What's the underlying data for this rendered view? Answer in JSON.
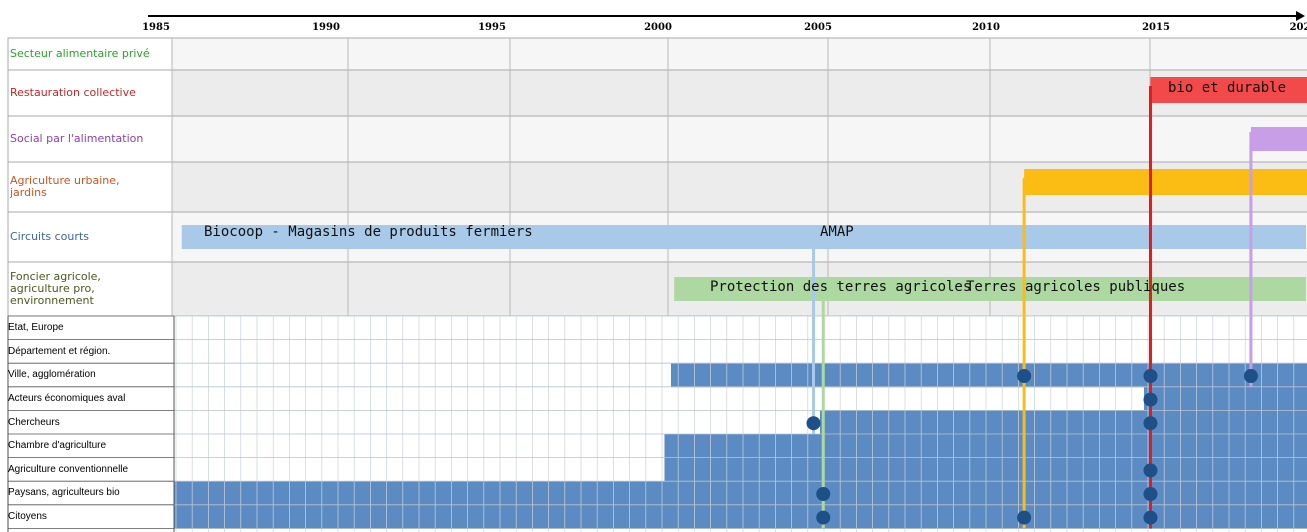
{
  "timeline": {
    "year_start": 1985,
    "year_end": 2020,
    "ticks": [
      "1985",
      "1990",
      "1995",
      "2000",
      "2005",
      "2010",
      "2015",
      "202"
    ]
  },
  "categories": [
    {
      "label": "Secteur alimentaire privé",
      "color": "#2e9e2e"
    },
    {
      "label": "Restauration collective",
      "color": "#c0282a"
    },
    {
      "label": "Social par l'alimentation",
      "color": "#8a3fb0"
    },
    {
      "label": "Agriculture urbaine,\njardins",
      "color": "#c8561e"
    },
    {
      "label": "Circuits courts",
      "color": "#3a63a8"
    },
    {
      "label": "Foncier agricole,\nagriculture pro,\nenvironnement",
      "color": "#4a5a1e"
    }
  ],
  "phases": [
    {
      "label": "bio et durable",
      "color": "#f24a4a",
      "row": 1,
      "from": 2015.2,
      "to": 2020.1
    },
    {
      "label": "",
      "color": "#c89ee8",
      "row": 2,
      "from": 2018.3,
      "to": 2020.1
    },
    {
      "label": "",
      "color": "#fbbd13",
      "row": 3,
      "from": 2011.3,
      "to": 2020.1
    },
    {
      "label": "Biocoop - Magasins de produits fermiers",
      "color": "#a9c9e9",
      "row": 4,
      "from": 1985.3,
      "to": 2020.0
    },
    {
      "label": "AMAP",
      "color": "#a9c9e9",
      "row": 4,
      "from": 2004.8,
      "to": 2006.5
    },
    {
      "label": "Protection des terres agricoles",
      "color": "#add8a1",
      "row": 5,
      "from": 2000.5,
      "to": 2009.0
    },
    {
      "label": "Terres agricoles publiques",
      "color": "#add8a1",
      "row": 5,
      "from": 2009.0,
      "to": 2020.0
    }
  ],
  "actors": [
    "Etat, Europe",
    "Département et région.",
    "Ville, agglomération",
    "Acteurs économiques aval",
    "Chercheurs",
    "Chambre d'agriculture",
    "Agriculture conventionnelle",
    "Paysans, agriculteurs bio",
    "Citoyens"
  ],
  "involvement": [
    {
      "actor": 2,
      "from": 2000.4,
      "to": 2020.1
    },
    {
      "actor": 3,
      "from": 2015.0,
      "to": 2020.1
    },
    {
      "actor": 4,
      "from": 2005.0,
      "to": 2020.1
    },
    {
      "actor": 5,
      "from": 2000.2,
      "to": 2020.1
    },
    {
      "actor": 6,
      "from": 2000.2,
      "to": 2020.1
    },
    {
      "actor": 7,
      "from": 1985.0,
      "to": 2020.1
    },
    {
      "actor": 8,
      "from": 1985.0,
      "to": 2020.1
    }
  ],
  "connectors": [
    {
      "year": 2004.8,
      "color": "#a9c9e9",
      "from_row": 4,
      "dots": [
        4
      ]
    },
    {
      "year": 2005.1,
      "color": "#add8a1",
      "from_row": 5,
      "dots": [
        7,
        8
      ]
    },
    {
      "year": 2011.3,
      "color": "#fbbd13",
      "from_row": 3,
      "dots": [
        2,
        8
      ]
    },
    {
      "year": 2015.2,
      "color": "#e21c1c",
      "from_row": 1,
      "dots": [
        2,
        3,
        4,
        6,
        7,
        8
      ]
    },
    {
      "year": 2018.3,
      "color": "#c89ee8",
      "from_row": 2,
      "dots": [
        2
      ]
    }
  ]
}
